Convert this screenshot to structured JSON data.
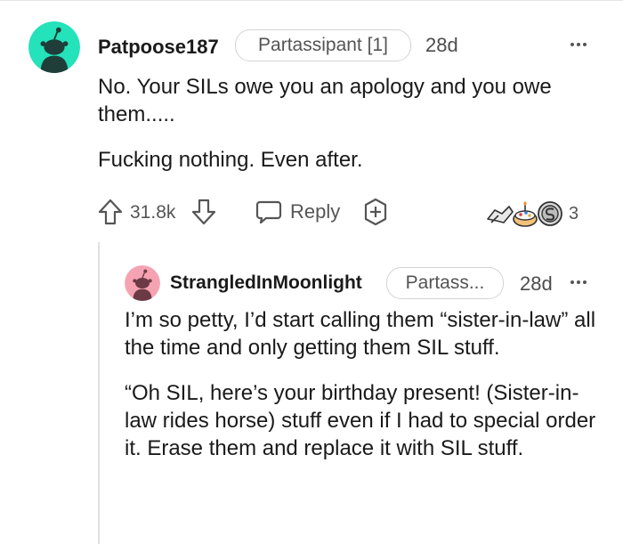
{
  "comment": {
    "username": "Patpoose187",
    "flair": "Partassipant [1]",
    "age": "28d",
    "paragraphs": [
      "No. Your SILs owe you an apology and you owe them.....",
      "Fucking nothing. Even after."
    ],
    "score": "31.8k",
    "reply_label": "Reply",
    "award_count": "3",
    "icons": [
      "avatar-icon",
      "more-icon",
      "upvote-icon",
      "downvote-icon",
      "reply-icon",
      "give-award-icon",
      "award-icon"
    ]
  },
  "reply": {
    "username": "StrangledInMoonlight",
    "flair": "Partass...",
    "age": "28d",
    "paragraphs": [
      "I’m so petty, I’d start calling them “sister-in-law” all the time and only getting them SIL stuff.",
      "“Oh SIL, here’s your birthday present! (Sister-in-law rides horse) stuff even if I had to special order it. Erase them and replace it with SIL stuff."
    ]
  },
  "colors": {
    "avatar_primary": "#24e2ba",
    "avatar_secondary": "#f5a3b3",
    "text": "#1a1a1b",
    "meta": "#555555"
  }
}
